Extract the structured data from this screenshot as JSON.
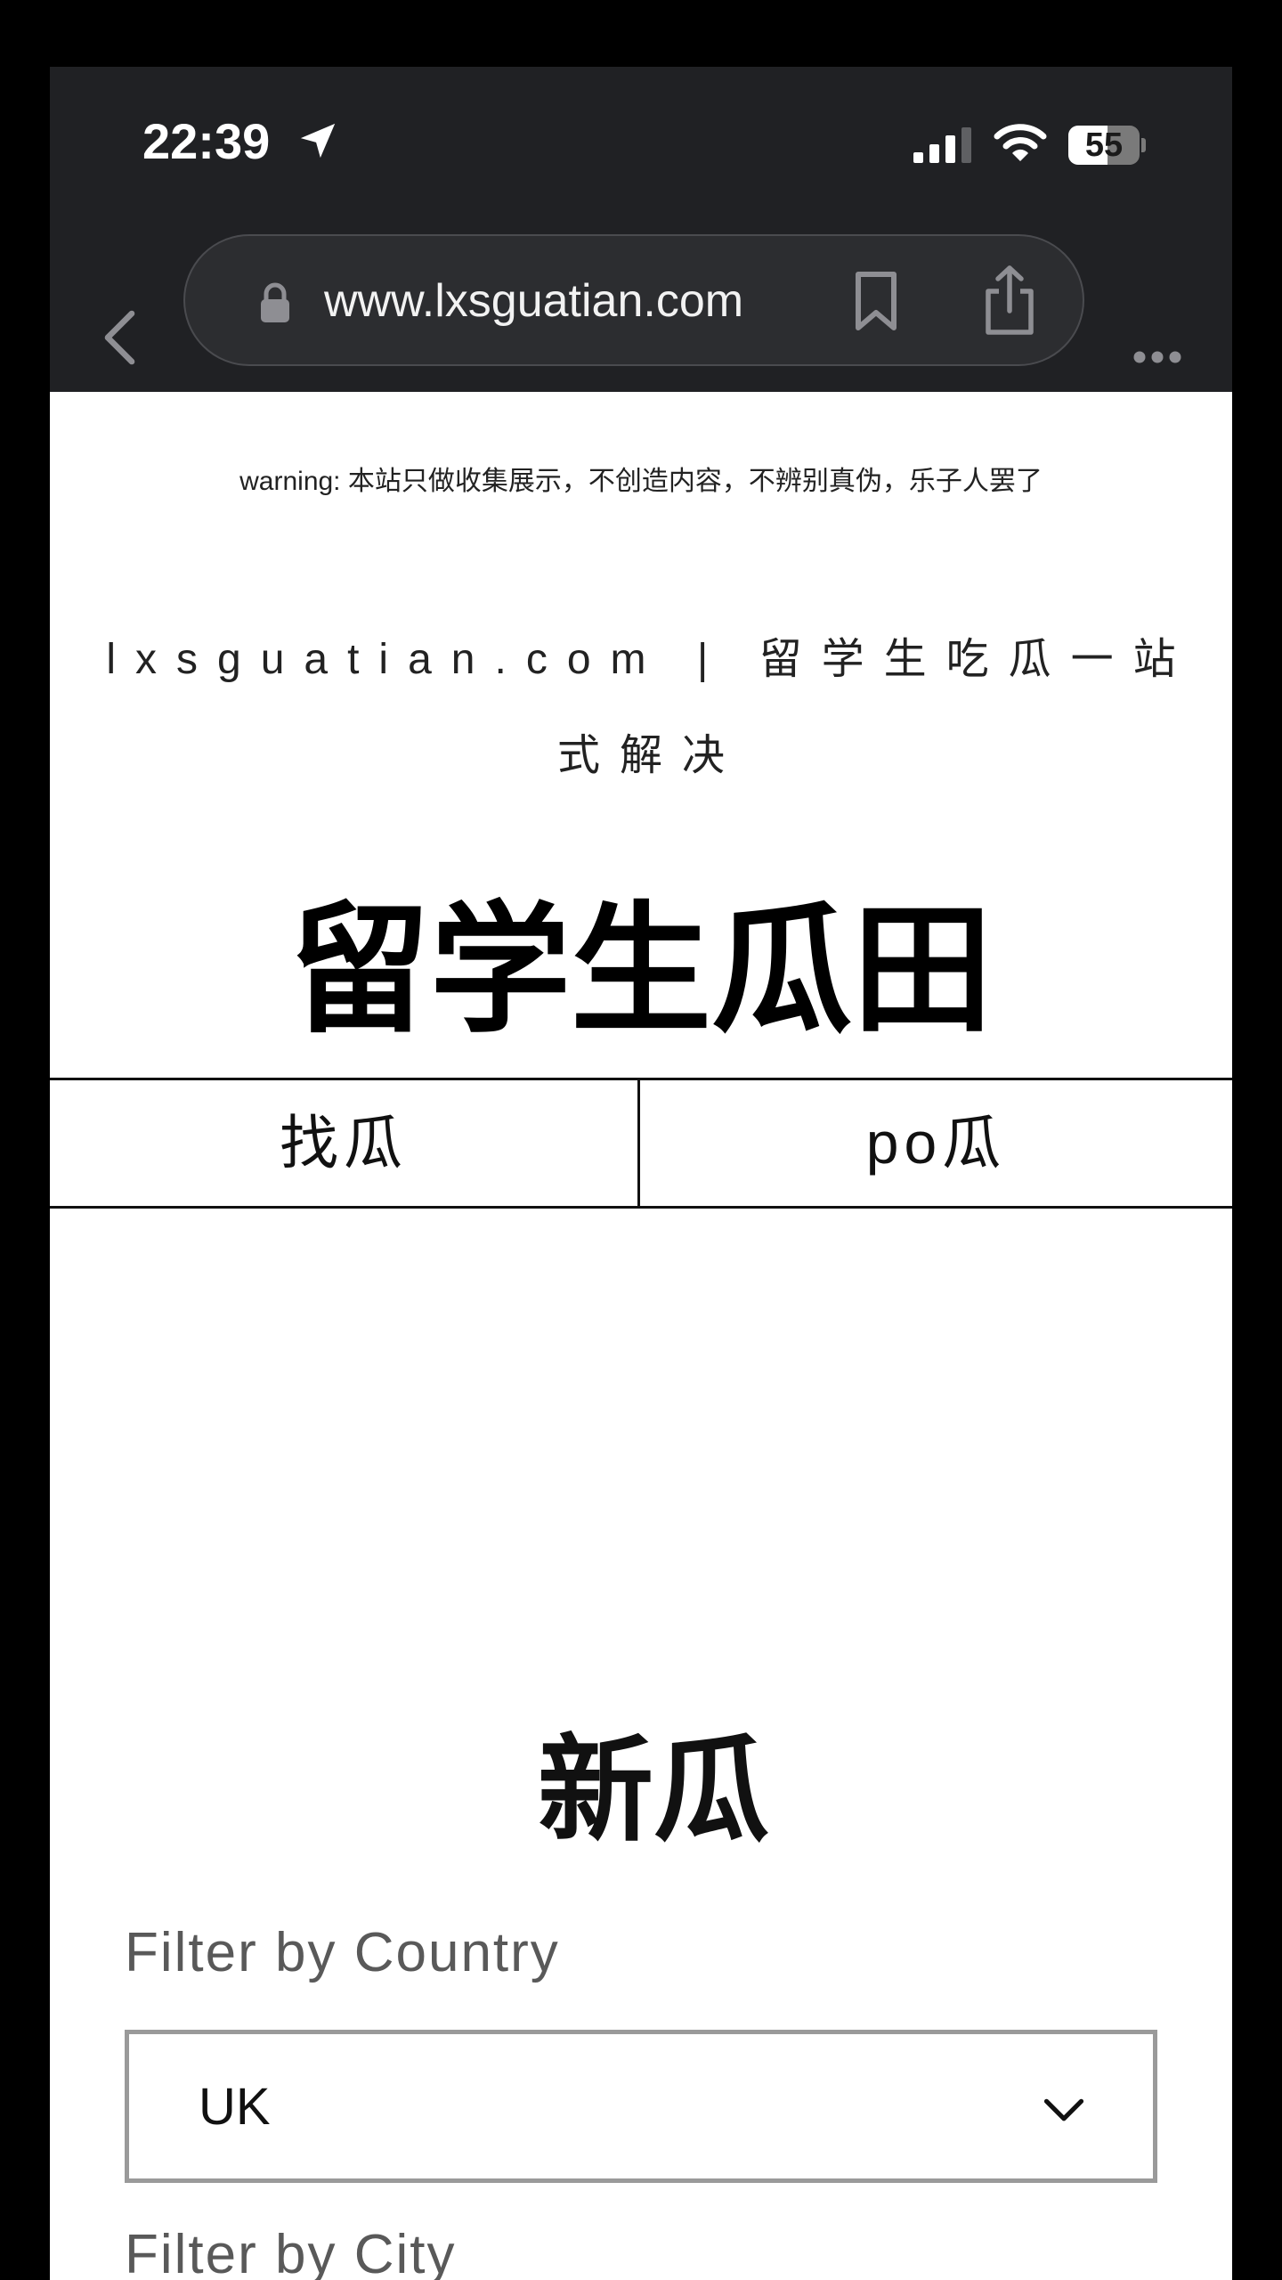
{
  "status_bar": {
    "time": "22:39",
    "battery_level": "55",
    "battery_fraction": 0.55
  },
  "browser": {
    "url": "www.lxsguatian.com"
  },
  "page": {
    "warning": "warning: 本站只做收集展示，不创造内容，不辨别真伪，乐子人罢了",
    "tagline": "lxsguatian.com | 留学生吃瓜一站式解决",
    "title": "留学生瓜田",
    "nav": {
      "find_label": "找瓜",
      "post_label": "po瓜"
    },
    "section_title": "新瓜",
    "filters": {
      "country_label": "Filter by Country",
      "country_value": "UK",
      "city_label": "Filter by City"
    }
  },
  "icons": {
    "location": "location-arrow-icon",
    "signal": "cellular-signal-icon",
    "wifi": "wifi-icon",
    "back": "chevron-left-icon",
    "lock": "lock-icon",
    "bookmark": "bookmark-icon",
    "share": "share-icon",
    "more": "more-horizontal-icon",
    "dropdown": "chevron-down-icon"
  },
  "colors": {
    "chrome_background": "#202124",
    "page_background": "#ffffff",
    "text_primary": "#111111",
    "filter_label": "#595959",
    "select_border": "#9a9a9a"
  }
}
